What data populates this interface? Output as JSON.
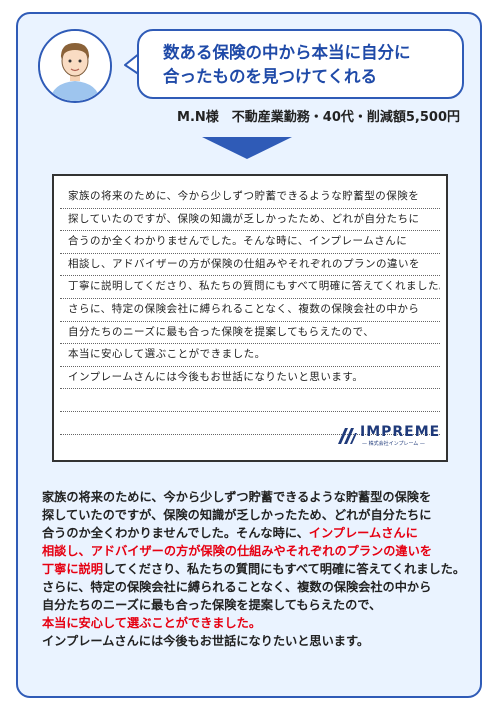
{
  "testimonial": {
    "headline_lines": [
      "数ある保険の中から本当に自分に",
      "合ったものを見つけてくれる"
    ],
    "customer_profile": "M.N様　不動産業勤務・40代・削減額5,500円",
    "handwritten_lines": [
      "家族の将来のために、今から少しずつ貯蓄できるような貯蓄型の保険を",
      "探していたのですが、保険の知識が乏しかったため、どれが自分たちに",
      "合うのか全くわかりませんでした。そんな時に、インプレームさんに",
      "相談し、アドバイザーの方が保険の仕組みやそれぞれのプランの違いを",
      "丁寧に説明してくださり、私たちの質問にもすべて明確に答えてくれました。",
      "さらに、特定の保険会社に縛られることなく、複数の保険会社の中から",
      "自分たちのニーズに最も合った保険を提案してもらえたので、",
      "本当に安心して選ぶことができました。",
      "インプレームさんには今後もお世話になりたいと思います。",
      "",
      ""
    ],
    "logo": {
      "text": "IMPREME",
      "subtext": "— 株式会社インプレーム —"
    },
    "body": {
      "line1": "家族の将来のために、今から少しずつ貯蓄できるような貯蓄型の保険を",
      "line2": "探していたのですが、保険の知識が乏しかったため、どれが自分たちに",
      "line3_plain": "合うのか全くわかりませんでした。そんな時に、",
      "line3_red": "インプレームさんに",
      "line4_red": "相談し、アドバイザーの方が保険の仕組みやそれぞれのプランの違いを",
      "line5_red": "丁寧に説明",
      "line5_plain": "してくださり、私たちの質問にもすべて明確に答えてくれました。",
      "line6": "さらに、特定の保険会社に縛られることなく、複数の保険会社の中から",
      "line7": "自分たちのニーズに最も合った保険を提案してもらえたので、",
      "line8_red": "本当に安心して選ぶことができました。",
      "line9": "インプレームさんには今後もお世話になりたいと思います。"
    }
  },
  "colors": {
    "accent_blue": "#2f5bb7",
    "card_background": "#eaf3ff",
    "highlight_red": "#e60012"
  },
  "icons": [
    "customer-avatar-icon",
    "down-arrow-icon",
    "impreme-logo-icon"
  ]
}
